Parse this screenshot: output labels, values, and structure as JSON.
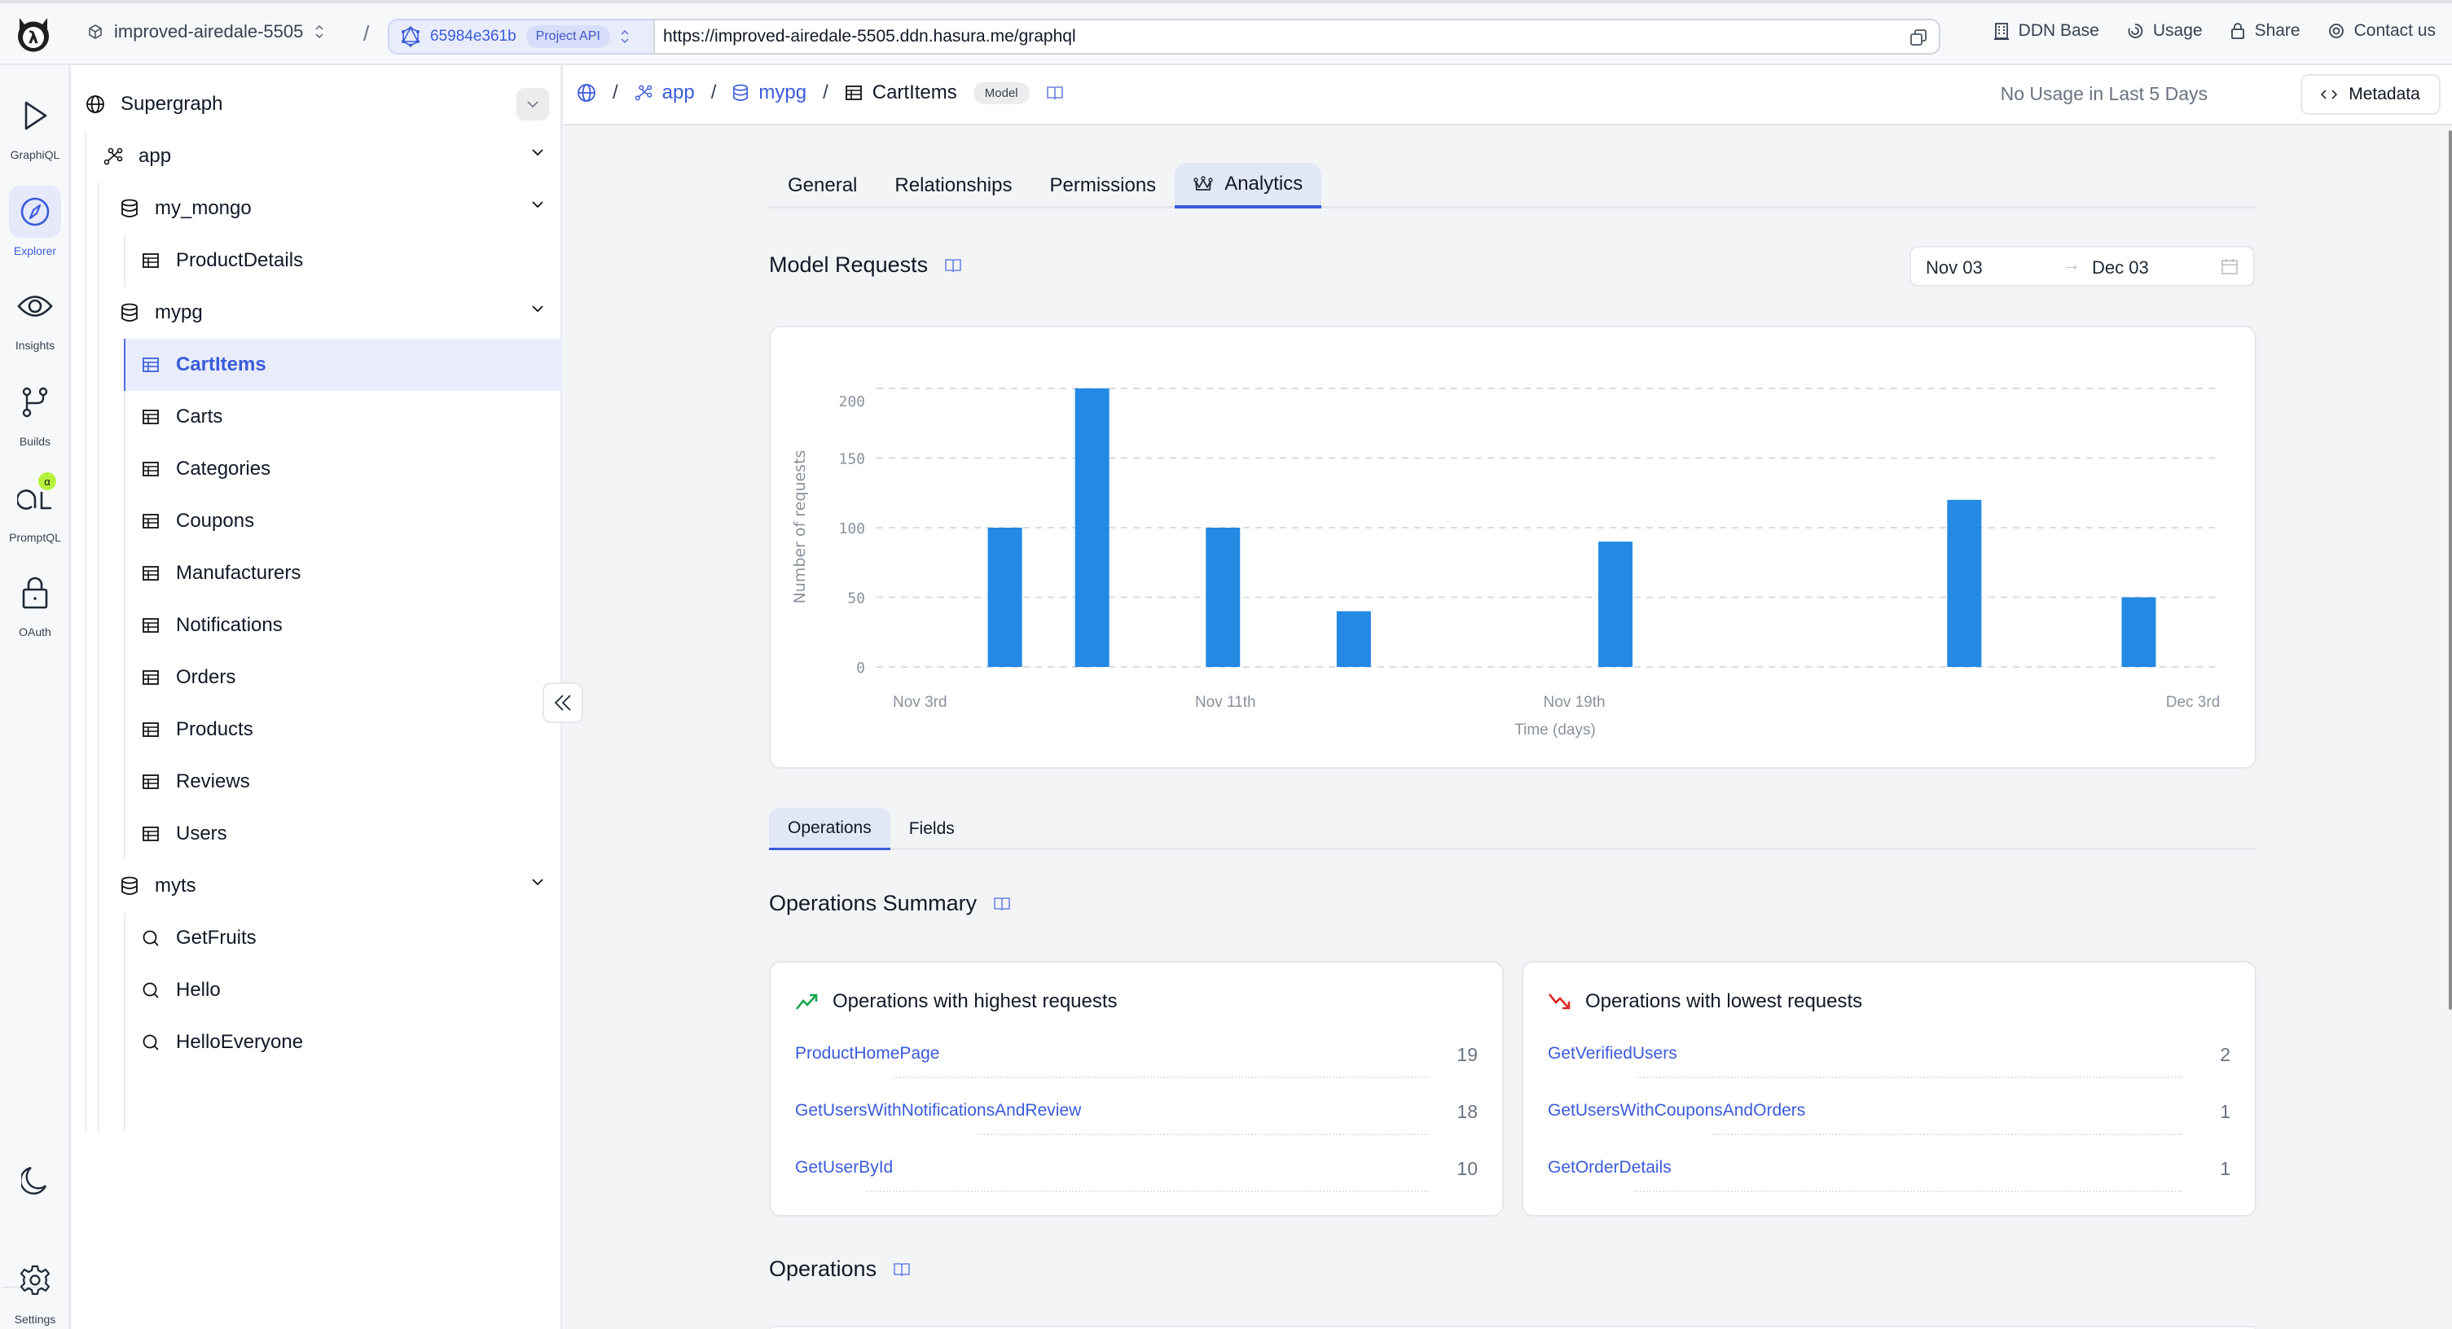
{
  "topbar": {
    "project_name": "improved-airedale-5505",
    "build_id": "65984e361b",
    "api_badge": "Project API",
    "url": "https://improved-airedale-5505.ddn.hasura.me/graphql",
    "nav": [
      {
        "label": "DDN Base",
        "icon": "building-icon"
      },
      {
        "label": "Usage",
        "icon": "usage-icon"
      },
      {
        "label": "Share",
        "icon": "lock-icon"
      },
      {
        "label": "Contact us",
        "icon": "at-icon"
      }
    ]
  },
  "rail": {
    "items": [
      {
        "label": "GraphiQL",
        "icon": "play-icon",
        "active": false
      },
      {
        "label": "Explorer",
        "icon": "compass-icon",
        "active": true
      },
      {
        "label": "Insights",
        "icon": "eye-icon",
        "active": false
      },
      {
        "label": "Builds",
        "icon": "git-branch-icon",
        "active": false
      },
      {
        "label": "PromptQL",
        "icon": "promptql-icon",
        "active": false,
        "badge": "α"
      },
      {
        "label": "OAuth",
        "icon": "lock-icon",
        "active": false
      }
    ],
    "theme_toggle_icon": "moon-icon",
    "settings_label": "Settings"
  },
  "tree": {
    "root": "Supergraph",
    "subgraph": "app",
    "connectors": [
      {
        "name": "my_mongo",
        "items": [
          {
            "name": "ProductDetails",
            "kind": "model"
          }
        ]
      },
      {
        "name": "mypg",
        "items": [
          {
            "name": "CartItems",
            "kind": "model",
            "selected": true
          },
          {
            "name": "Carts",
            "kind": "model"
          },
          {
            "name": "Categories",
            "kind": "model"
          },
          {
            "name": "Coupons",
            "kind": "model"
          },
          {
            "name": "Manufacturers",
            "kind": "model"
          },
          {
            "name": "Notifications",
            "kind": "model"
          },
          {
            "name": "Orders",
            "kind": "model"
          },
          {
            "name": "Products",
            "kind": "model"
          },
          {
            "name": "Reviews",
            "kind": "model"
          },
          {
            "name": "Users",
            "kind": "model"
          }
        ]
      },
      {
        "name": "myts",
        "items": [
          {
            "name": "GetFruits",
            "kind": "command"
          },
          {
            "name": "Hello",
            "kind": "command"
          },
          {
            "name": "HelloEveryone",
            "kind": "command"
          }
        ]
      }
    ]
  },
  "header": {
    "breadcrumb": [
      "app",
      "mypg",
      "CartItems"
    ],
    "badge": "Model",
    "usage_note": "No Usage in Last 5 Days",
    "metadata_button": "Metadata"
  },
  "tabs": [
    {
      "label": "General",
      "active": false
    },
    {
      "label": "Relationships",
      "active": false
    },
    {
      "label": "Permissions",
      "active": false
    },
    {
      "label": "Analytics",
      "active": true
    }
  ],
  "model_requests": {
    "title": "Model Requests",
    "date_from": "Nov 03",
    "date_to": "Dec 03",
    "date_arrow": "→"
  },
  "chart_data": {
    "type": "bar",
    "title": "",
    "xlabel": "Time (days)",
    "ylabel": "Number of requests",
    "x_range": [
      "Nov 3rd",
      "Dec 3rd"
    ],
    "x_ticks": [
      "Nov 3rd",
      "Nov 11th",
      "Nov 19th",
      "Dec 3rd"
    ],
    "y_ticks": [
      0,
      50,
      100,
      150,
      200
    ],
    "ylim": [
      0,
      200
    ],
    "grid": true,
    "categories": [
      "Nov 6th",
      "Nov 8th",
      "Nov 11th",
      "Nov 14th",
      "Nov 20th",
      "Nov 28th",
      "Dec 2nd"
    ],
    "day_offsets": [
      3,
      5,
      8,
      11,
      17,
      25,
      29
    ],
    "values": [
      100,
      200,
      100,
      40,
      90,
      120,
      50
    ],
    "color": "#2389e3"
  },
  "subtabs": [
    {
      "label": "Operations",
      "active": true
    },
    {
      "label": "Fields",
      "active": false
    }
  ],
  "operations_summary": {
    "title": "Operations Summary",
    "highest": {
      "title": "Operations with highest requests",
      "rows": [
        {
          "name": "ProductHomePage",
          "count": "19"
        },
        {
          "name": "GetUsersWithNotificationsAndReview",
          "count": "18"
        },
        {
          "name": "GetUserById",
          "count": "10"
        }
      ]
    },
    "lowest": {
      "title": "Operations with lowest requests",
      "rows": [
        {
          "name": "GetVerifiedUsers",
          "count": "2"
        },
        {
          "name": "GetUsersWithCouponsAndOrders",
          "count": "1"
        },
        {
          "name": "GetOrderDetails",
          "count": "1"
        }
      ]
    }
  },
  "operations": {
    "title": "Operations"
  },
  "colors": {
    "accent": "#3b5bdb",
    "bar": "#2389e3",
    "trend_up": "#16a34a",
    "trend_down": "#dc2626",
    "badge_alpha": "#b6f23d"
  }
}
